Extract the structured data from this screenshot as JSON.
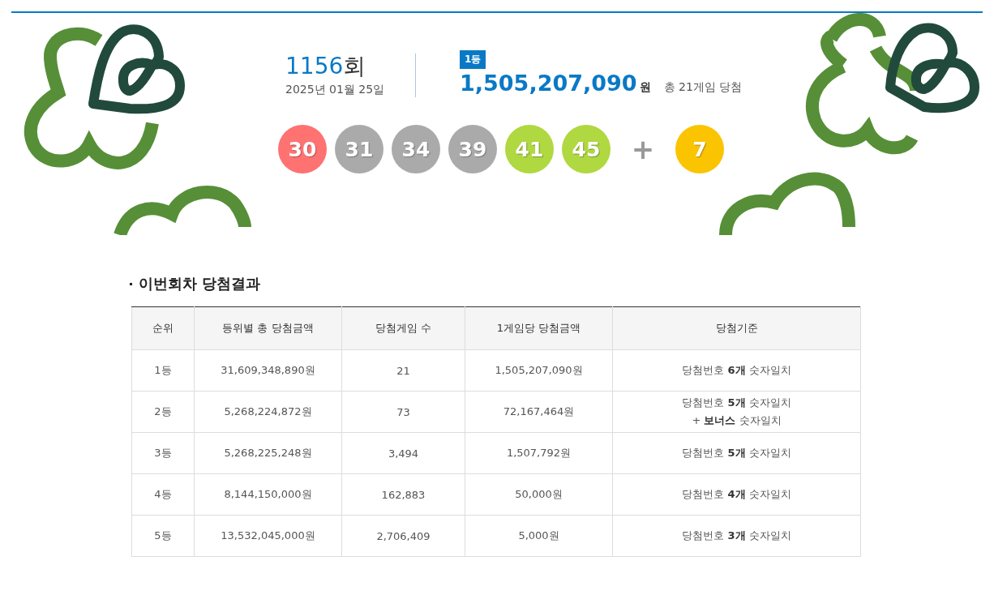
{
  "draw": {
    "round": "1156",
    "round_suffix": "회",
    "date": "2025년 01월 25일",
    "rank_badge": "1등",
    "first_prize": "1,505,207,090",
    "currency": "원",
    "winners_text": "총 21게임 당첨",
    "numbers": [
      {
        "value": "30",
        "color": "#ff7272"
      },
      {
        "value": "31",
        "color": "#aaaaaa"
      },
      {
        "value": "34",
        "color": "#aaaaaa"
      },
      {
        "value": "39",
        "color": "#aaaaaa"
      },
      {
        "value": "41",
        "color": "#b0d840"
      },
      {
        "value": "45",
        "color": "#b0d840"
      }
    ],
    "plus": "+",
    "bonus": {
      "value": "7",
      "color": "#fbc400"
    }
  },
  "results": {
    "title": "이번회차 당첨결과",
    "columns": [
      "순위",
      "등위별 총 당첨금액",
      "당첨게임 수",
      "1게임당 당첨금액",
      "당첨기준"
    ],
    "rows": [
      {
        "rank": "1등",
        "total": "31,609,348,890원",
        "winners": "21",
        "per_game": "1,505,207,090원",
        "criteria": [
          "당첨번호 **6개** 숫자일치"
        ]
      },
      {
        "rank": "2등",
        "total": "5,268,224,872원",
        "winners": "73",
        "per_game": "72,167,464원",
        "criteria": [
          "당첨번호 **5개** 숫자일치",
          "+ **보너스** 숫자일치"
        ]
      },
      {
        "rank": "3등",
        "total": "5,268,225,248원",
        "winners": "3,494",
        "per_game": "1,507,792원",
        "criteria": [
          "당첨번호 **5개** 숫자일치"
        ]
      },
      {
        "rank": "4등",
        "total": "8,144,150,000원",
        "winners": "162,883",
        "per_game": "50,000원",
        "criteria": [
          "당첨번호 **4개** 숫자일치"
        ]
      },
      {
        "rank": "5등",
        "total": "13,532,045,000원",
        "winners": "2,706,409",
        "per_game": "5,000원",
        "criteria": [
          "당첨번호 **3개** 숫자일치"
        ]
      }
    ]
  }
}
